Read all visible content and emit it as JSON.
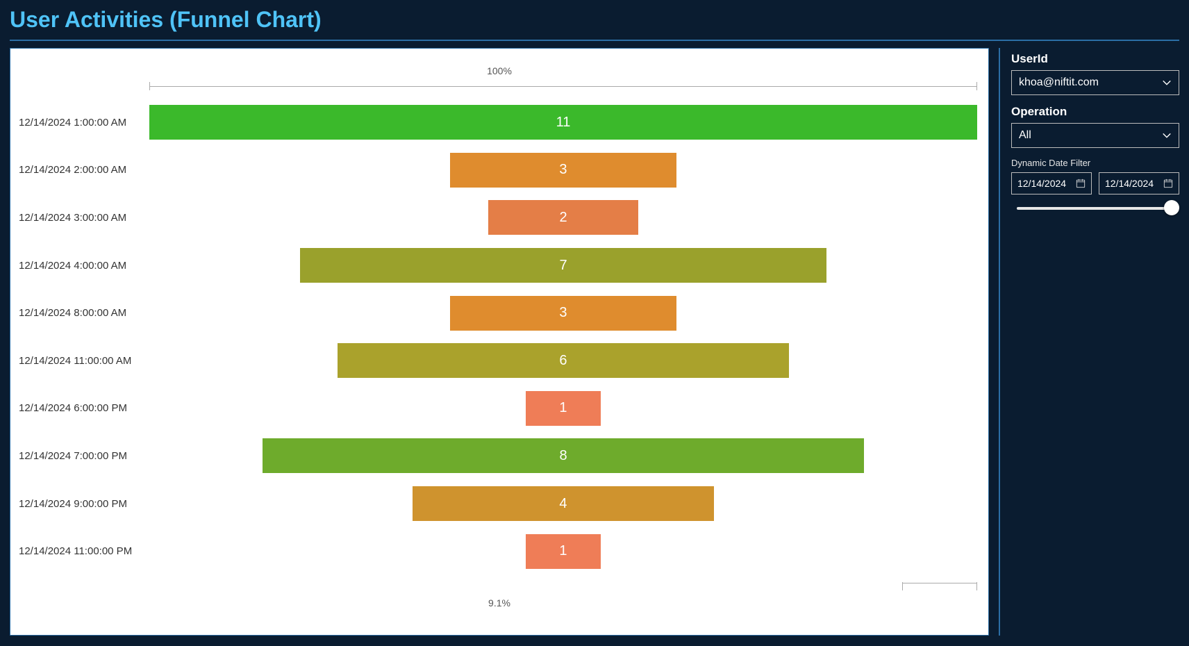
{
  "title": "User Activities (Funnel Chart)",
  "filters": {
    "userid_label": "UserId",
    "userid_value": "khoa@niftit.com",
    "operation_label": "Operation",
    "operation_value": "All",
    "date_filter_label": "Dynamic Date Filter",
    "date_from": "12/14/2024",
    "date_to": "12/14/2024"
  },
  "chart_data": {
    "type": "bar",
    "title": "User Activities (Funnel Chart)",
    "top_pct_label": "100%",
    "bottom_pct_label": "9.1%",
    "max_value": 11,
    "categories": [
      "12/14/2024 1:00:00 AM",
      "12/14/2024 2:00:00 AM",
      "12/14/2024 3:00:00 AM",
      "12/14/2024 4:00:00 AM",
      "12/14/2024 8:00:00 AM",
      "12/14/2024 11:00:00 AM",
      "12/14/2024 6:00:00 PM",
      "12/14/2024 7:00:00 PM",
      "12/14/2024 9:00:00 PM",
      "12/14/2024 11:00:00 PM"
    ],
    "values": [
      11,
      3,
      2,
      7,
      3,
      6,
      1,
      8,
      4,
      1
    ],
    "colors": [
      "#3bb92b",
      "#df8c2e",
      "#e47e47",
      "#9aa12c",
      "#df8c2e",
      "#aaa22c",
      "#ef7d57",
      "#6eab2c",
      "#cf932e",
      "#ef7d57"
    ]
  }
}
